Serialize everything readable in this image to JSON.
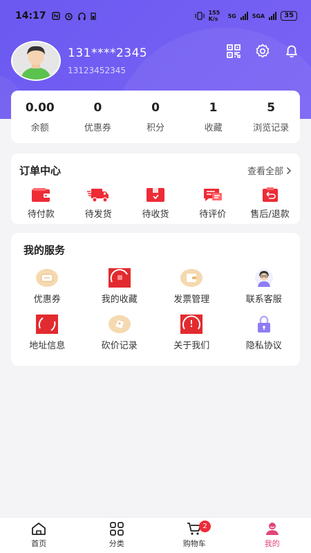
{
  "status_bar": {
    "time": "14:17",
    "speed": "155 K/s",
    "network": "5G",
    "network2": "5GA",
    "battery": "35"
  },
  "profile": {
    "name": "131****2345",
    "phone": "13123452345"
  },
  "stats": [
    {
      "value": "0.00",
      "label": "余额"
    },
    {
      "value": "0",
      "label": "优惠券"
    },
    {
      "value": "0",
      "label": "积分"
    },
    {
      "value": "1",
      "label": "收藏"
    },
    {
      "value": "5",
      "label": "浏览记录"
    }
  ],
  "orders": {
    "title": "订单中心",
    "see_all": "查看全部",
    "items": [
      {
        "label": "待付款",
        "icon": "wallet-icon"
      },
      {
        "label": "待发货",
        "icon": "truck-icon"
      },
      {
        "label": "待收货",
        "icon": "box-icon"
      },
      {
        "label": "待评价",
        "icon": "comment-icon"
      },
      {
        "label": "售后/退款",
        "icon": "refund-icon"
      }
    ]
  },
  "services": {
    "title": "我的服务",
    "items": [
      {
        "label": "优惠券",
        "icon": "coupon-icon"
      },
      {
        "label": "我的收藏",
        "icon": "favorites-icon"
      },
      {
        "label": "发票管理",
        "icon": "invoice-icon"
      },
      {
        "label": "联系客服",
        "icon": "customer-service-icon"
      },
      {
        "label": "地址信息",
        "icon": "address-icon"
      },
      {
        "label": "砍价记录",
        "icon": "bargain-icon"
      },
      {
        "label": "关于我们",
        "icon": "about-icon"
      },
      {
        "label": "隐私协议",
        "icon": "lock-icon"
      }
    ]
  },
  "tabbar": {
    "items": [
      {
        "label": "首页",
        "icon": "home-icon"
      },
      {
        "label": "分类",
        "icon": "category-icon"
      },
      {
        "label": "购物车",
        "icon": "cart-icon",
        "badge": "2"
      },
      {
        "label": "我的",
        "icon": "profile-icon"
      }
    ]
  },
  "colors": {
    "header": "#6b59f0",
    "accent_red": "#ee2b36",
    "active_tab": "#e0467a"
  }
}
